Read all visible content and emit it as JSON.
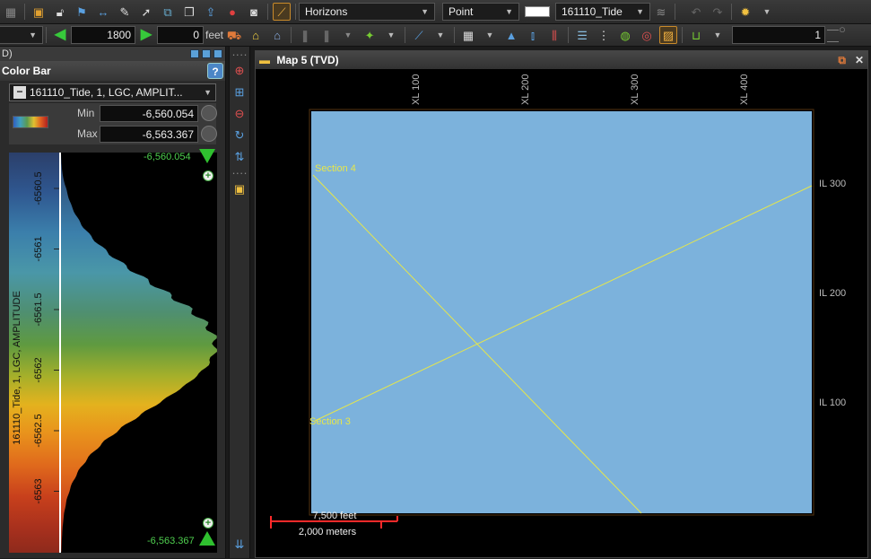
{
  "toolbar_top": {
    "layer_dropdown": "Horizons",
    "mode_dropdown": "Point",
    "horizon_dropdown": "161110_Tide"
  },
  "toolbar_second": {
    "value_field": "1800",
    "offset_field": "0",
    "unit_label": "feet",
    "step_field": "1"
  },
  "left_panel": {
    "partial_tab": "D)",
    "title": "Color Bar",
    "help_label": "?",
    "attribute_select": "161110_Tide, 1, LGC, AMPLIT...",
    "min_label": "Min",
    "min_value": "-6,560.054",
    "max_label": "Max",
    "max_value": "-6,563.367",
    "top_value": "-6,560.054",
    "bottom_value": "-6,563.367",
    "vertical_axis_label": "161110_Tide, 1, LGC, AMPLITUDE",
    "ticks": [
      "-6560.5",
      "-6561",
      "-6561.5",
      "-6562",
      "-6562.5",
      "-6563"
    ]
  },
  "map": {
    "title": "Map 5 (TVD)",
    "xl_labels": [
      "XL 100",
      "XL 200",
      "XL 300",
      "XL 400"
    ],
    "il_labels": [
      "IL 300",
      "IL 200",
      "IL 100"
    ],
    "section_labels": [
      "Section 4",
      "Section 3"
    ],
    "scale_feet": "7,500 feet",
    "scale_meters": "2,000 meters"
  },
  "colors": {
    "accent_orange": "#e07a3a",
    "line_yellow": "#e6e64a",
    "label_green": "#4fd04f",
    "scale_red": "#ff2a2a"
  }
}
